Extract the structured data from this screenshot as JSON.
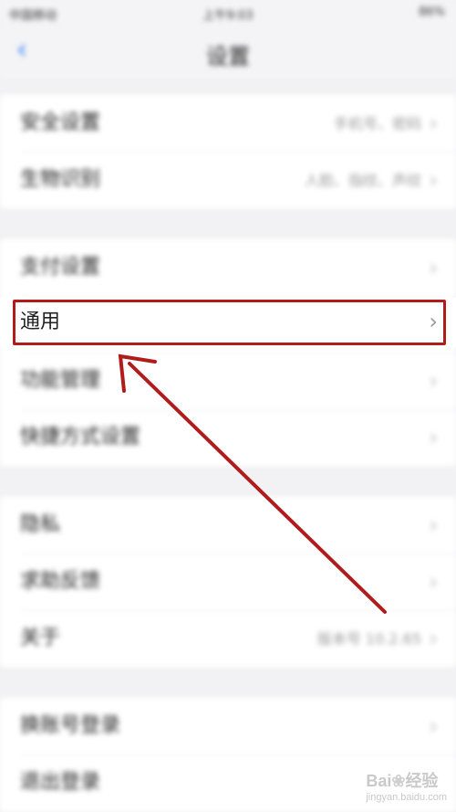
{
  "status_bar": {
    "carrier": "中国移动",
    "time": "上午9:03",
    "battery": "86%"
  },
  "nav": {
    "back_glyph": "‹",
    "title": "设置"
  },
  "groups": [
    {
      "items": [
        {
          "label": "安全设置",
          "value": "手机号、密码"
        },
        {
          "label": "生物识别",
          "value": "人脸、指纹、声纹"
        }
      ]
    },
    {
      "items": [
        {
          "label": "支付设置",
          "value": ""
        },
        {
          "label": "通用",
          "value": ""
        },
        {
          "label": "功能管理",
          "value": ""
        },
        {
          "label": "快捷方式设置",
          "value": ""
        }
      ]
    },
    {
      "items": [
        {
          "label": "隐私",
          "value": ""
        },
        {
          "label": "求助反馈",
          "value": ""
        },
        {
          "label": "关于",
          "value": "版本号 10.2.65"
        }
      ]
    },
    {
      "items": [
        {
          "label": "换账号登录",
          "value": ""
        },
        {
          "label": "退出登录",
          "value": ""
        }
      ]
    }
  ],
  "chevron_glyph": "›",
  "annotation": {
    "color": "#b01c1c",
    "target": "通用"
  },
  "watermark": {
    "brand": "Bai",
    "brand2": "经验",
    "sub": "jingyan.baidu.com"
  }
}
